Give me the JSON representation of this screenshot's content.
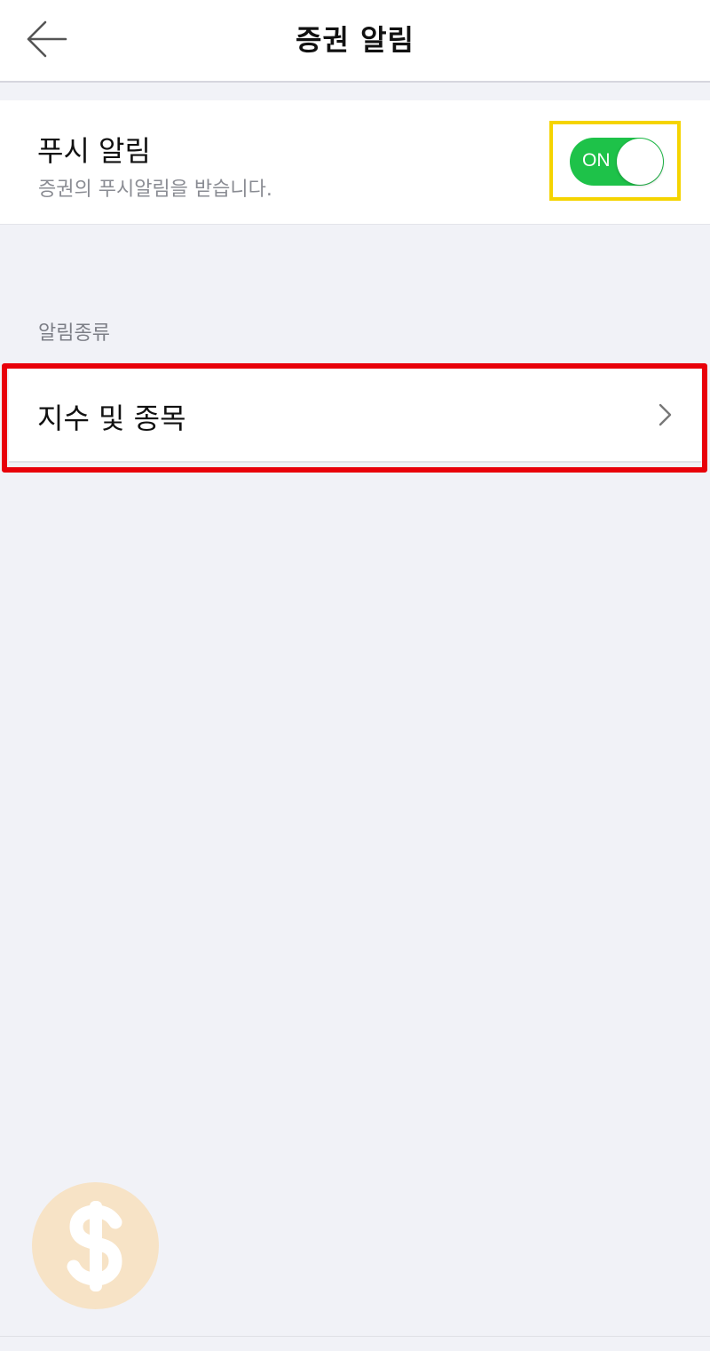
{
  "header": {
    "title": "증권 알림",
    "back_icon": "arrow-left-icon"
  },
  "push": {
    "title": "푸시 알림",
    "description": "증권의 푸시알림을 받습니다.",
    "toggle_label": "ON",
    "toggle_state": "on",
    "toggle_color": "#1ec249"
  },
  "alerts": {
    "section_label": "알림종류",
    "items": [
      {
        "label": "지수 및 종목",
        "icon": "chevron-right-icon"
      }
    ]
  },
  "colors": {
    "background": "#f1f2f7",
    "highlight_yellow": "#f5d400",
    "highlight_red": "#e8000a",
    "badge_bg": "#f7e3c6"
  },
  "badge": {
    "icon": "dollar-icon"
  }
}
